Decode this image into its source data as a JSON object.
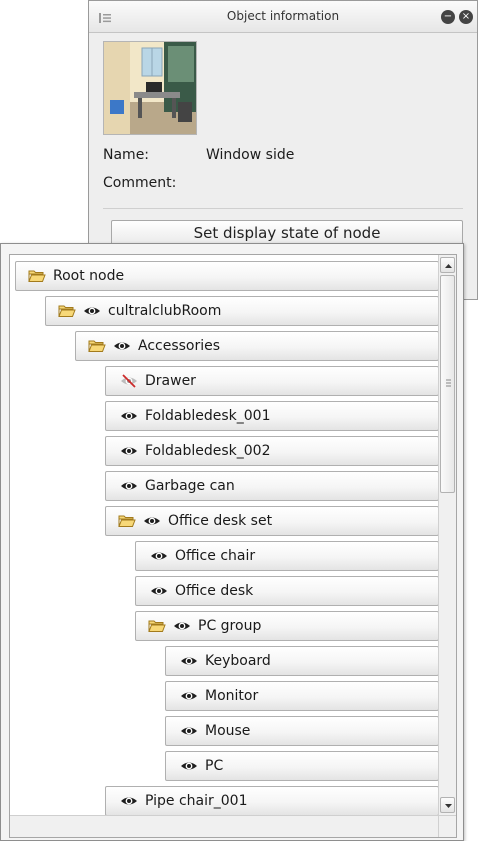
{
  "object_info": {
    "title": "Object information",
    "thumbnail_alt": "Classroom window side preview",
    "name_label": "Name:",
    "name_value": "Window side",
    "comment_label": "Comment:",
    "set_display_button": "Set display state of node",
    "icons": {
      "grip": "panel-grip-icon",
      "minimize": "minimize-icon",
      "close": "close-icon"
    }
  },
  "tree": {
    "nodes": [
      {
        "label": "Root node",
        "depth": 0,
        "folder": true,
        "eye": "none"
      },
      {
        "label": "cultralclubRoom",
        "depth": 1,
        "folder": true,
        "eye": "visible"
      },
      {
        "label": "Accessories",
        "depth": 2,
        "folder": true,
        "eye": "visible"
      },
      {
        "label": "Drawer",
        "depth": 3,
        "folder": false,
        "eye": "hidden"
      },
      {
        "label": "Foldabledesk_001",
        "depth": 3,
        "folder": false,
        "eye": "visible"
      },
      {
        "label": "Foldabledesk_002",
        "depth": 3,
        "folder": false,
        "eye": "visible"
      },
      {
        "label": "Garbage can",
        "depth": 3,
        "folder": false,
        "eye": "visible"
      },
      {
        "label": "Office desk set",
        "depth": 3,
        "folder": true,
        "eye": "visible"
      },
      {
        "label": "Office chair",
        "depth": 4,
        "folder": false,
        "eye": "visible"
      },
      {
        "label": "Office desk",
        "depth": 4,
        "folder": false,
        "eye": "visible"
      },
      {
        "label": "PC group",
        "depth": 4,
        "folder": true,
        "eye": "visible"
      },
      {
        "label": "Keyboard",
        "depth": 5,
        "folder": false,
        "eye": "visible"
      },
      {
        "label": "Monitor",
        "depth": 5,
        "folder": false,
        "eye": "visible"
      },
      {
        "label": "Mouse",
        "depth": 5,
        "folder": false,
        "eye": "visible"
      },
      {
        "label": "PC",
        "depth": 5,
        "folder": false,
        "eye": "visible"
      },
      {
        "label": "Pipe chair_001",
        "depth": 3,
        "folder": false,
        "eye": "visible"
      }
    ]
  },
  "colors": {
    "folder_fill": "#f7d878",
    "folder_stroke": "#a27a1c",
    "eye": "#1e1e1e",
    "hidden_slash": "#cc2a2a"
  }
}
